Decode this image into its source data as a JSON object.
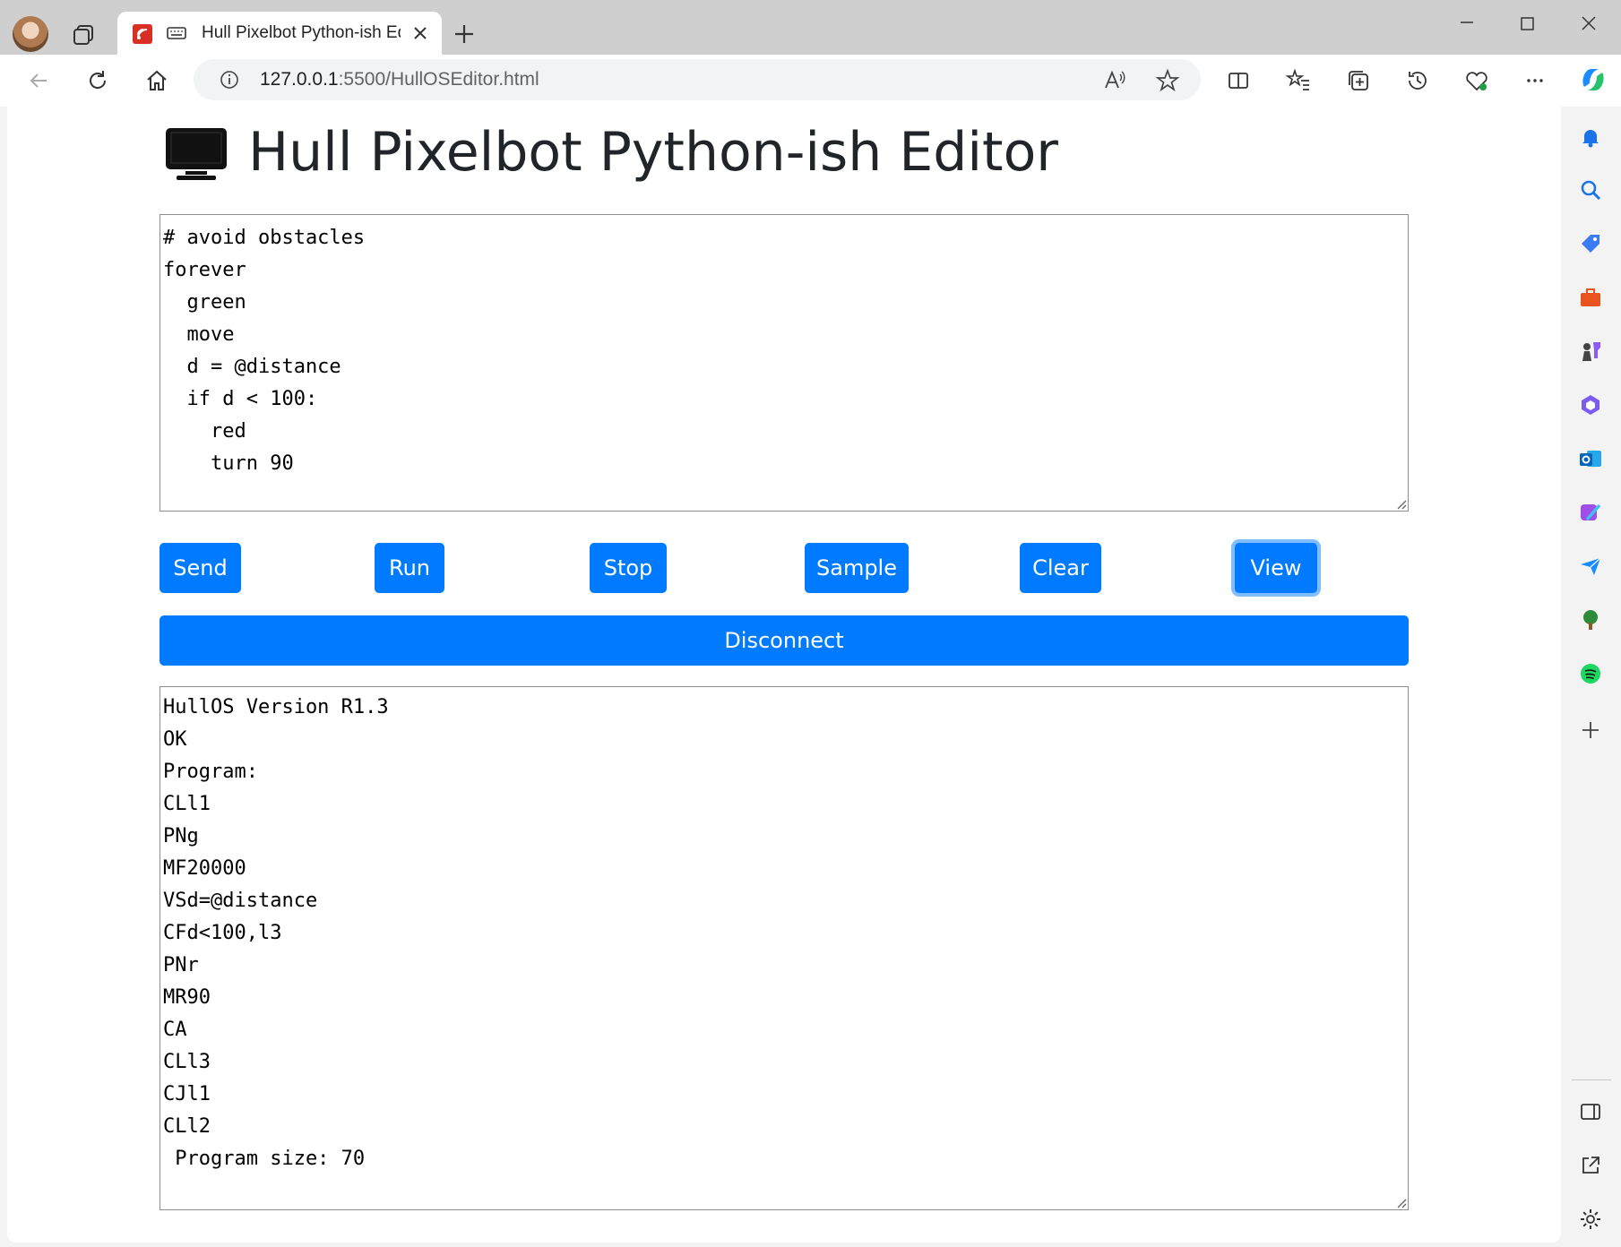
{
  "browser": {
    "tab_title": "Hull Pixelbot Python-ish Editor",
    "url_host": "127.0.0.1",
    "url_path": ":5500/HullOSEditor.html"
  },
  "page": {
    "title": "Hull Pixelbot Python-ish Editor",
    "code": "# avoid obstacles\nforever\n  green\n  move\n  d = @distance\n  if d < 100:\n    red\n    turn 90",
    "buttons": {
      "send": "Send",
      "run": "Run",
      "stop": "Stop",
      "sample": "Sample",
      "clear": "Clear",
      "view": "View",
      "disconnect": "Disconnect"
    },
    "output": "HullOS Version R1.3\nOK\nProgram:\nCLl1\nPNg\nMF20000\nVSd=@distance\nCFd<100,l3\nPNr\nMR90\nCA\nCLl3\nCJl1\nCLl2\n Program size: 70"
  },
  "colors": {
    "accent": "#007bff",
    "focus_ring": "#80bdff",
    "tabstrip": "#cfcfcf"
  }
}
